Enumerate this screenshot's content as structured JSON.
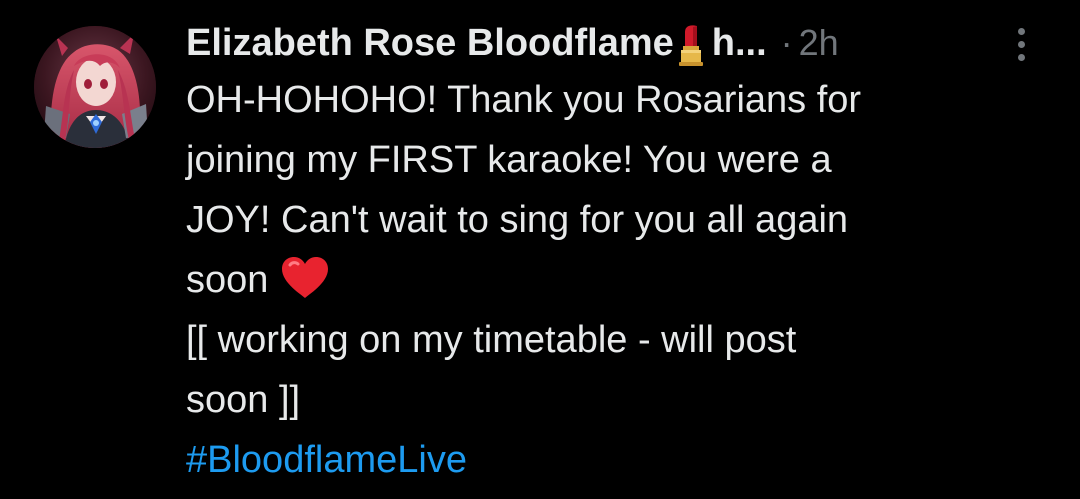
{
  "post": {
    "author": {
      "display_name": "Elizabeth Rose Bloodflame",
      "name_emoji": "lipstick-icon",
      "name_truncated": "h...",
      "avatar": "avatar-image"
    },
    "separator": "·",
    "timestamp": "2h",
    "more_icon": "more-vertical-icon",
    "text_lines": [
      "OH-HOHOHO! Thank you Rosarians for",
      "joining my FIRST karaoke! You were a",
      "JOY! Can't wait to sing for you all again",
      "soon",
      "[[ working on my timetable - will post",
      "soon ]]"
    ],
    "heart_emoji": "heart-icon",
    "hashtag": "#BloodflameLive"
  },
  "colors": {
    "background": "#000000",
    "text": "#e7e9ea",
    "secondary": "#71767b",
    "link": "#1d9bf0",
    "heart": "#e8232f",
    "lipstick_red": "#d11a2a"
  }
}
